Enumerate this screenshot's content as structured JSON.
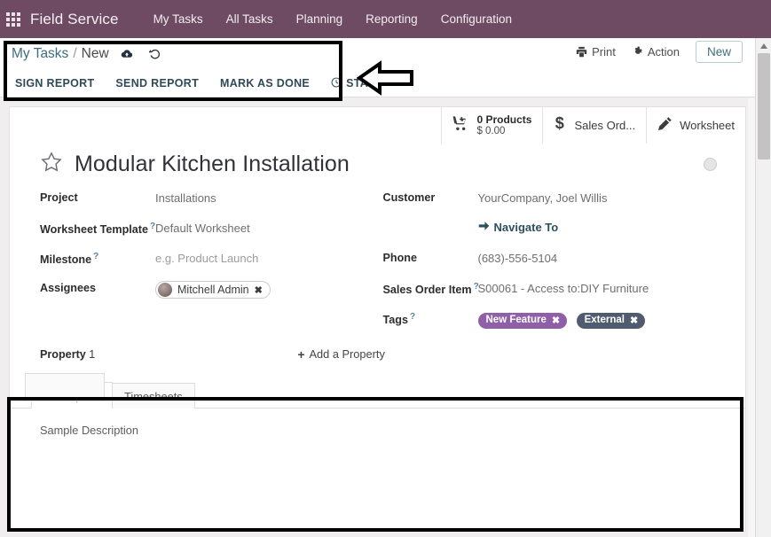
{
  "navbar": {
    "apps_icon": "apps-grid-icon",
    "brand": "Field Service",
    "menu": [
      {
        "label": "My Tasks"
      },
      {
        "label": "All Tasks"
      },
      {
        "label": "Planning"
      },
      {
        "label": "Reporting"
      },
      {
        "label": "Configuration"
      }
    ],
    "background_color": "#6e4b63"
  },
  "control_panel": {
    "breadcrumb": {
      "parent": "My Tasks",
      "separator": "/",
      "current": "New",
      "save_icon": "cloud-save-icon",
      "discard_icon": "undo-discard-icon"
    },
    "right_actions": {
      "print_icon": "printer-icon",
      "print_label": "Print",
      "action_icon": "gear-icon",
      "action_label": "Action",
      "new_label": "New"
    },
    "status_buttons": [
      {
        "label": "SIGN REPORT",
        "icon": ""
      },
      {
        "label": "SEND REPORT",
        "icon": ""
      },
      {
        "label": "MARK AS DONE",
        "icon": ""
      },
      {
        "label": "START",
        "icon": "clock-icon"
      }
    ]
  },
  "stat_buttons": [
    {
      "icon": "cart-plus-icon",
      "line1": "0 Products",
      "line2": "$ 0.00"
    },
    {
      "icon": "dollar-icon",
      "label": "Sales Ord..."
    },
    {
      "icon": "pencil-icon",
      "label": "Worksheet"
    }
  ],
  "record": {
    "star_icon": "star-outline-icon",
    "title": "Modular Kitchen Installation",
    "kanban_state_icon": "kanban-state-circle"
  },
  "fields_left": [
    {
      "label": "Project",
      "help": false,
      "value": "Installations",
      "style": "muted"
    },
    {
      "label": "Worksheet Template",
      "help": true,
      "value": "Default Worksheet",
      "style": "muted"
    },
    {
      "label": "Milestone",
      "help": true,
      "value": "e.g. Product Launch",
      "style": "placeholder"
    },
    {
      "label": "Assignees",
      "help": false,
      "value": "Mitchell Admin",
      "style": "pill"
    }
  ],
  "fields_right": [
    {
      "label": "Customer",
      "help": false,
      "value": "YourCompany, Joel Willis",
      "style": "muted"
    },
    {
      "label": "",
      "help": false,
      "value": "Navigate To",
      "style": "link",
      "icon": "arrow-right-icon"
    },
    {
      "label": "Phone",
      "help": false,
      "value": "(683)-556-5104",
      "style": "muted"
    },
    {
      "label": "Sales Order Item",
      "help": true,
      "value": "S00061 - Access to:DIY Furniture",
      "style": "muted"
    },
    {
      "label": "Tags",
      "help": true,
      "style": "tags"
    }
  ],
  "tags": [
    {
      "label": "New Feature",
      "color": "#8f5fa8",
      "remove_icon": "remove-tag-icon"
    },
    {
      "label": "External",
      "color": "#4f5b6e",
      "remove_icon": "remove-tag-icon"
    }
  ],
  "properties": {
    "label_bold": "Property",
    "label_rest": " 1",
    "add_label": "Add a Property",
    "add_icon": "plus-icon"
  },
  "notebook": {
    "tabs": [
      {
        "label": "Description",
        "active": true
      },
      {
        "label": "Timesheets",
        "active": false
      }
    ],
    "description_text": "Sample Description"
  },
  "annotations": {
    "arrow": "left-pointing-arrow-annotation",
    "boxes": [
      "control-panel-highlight",
      "description-tab-highlight",
      "description-area-highlight"
    ]
  }
}
